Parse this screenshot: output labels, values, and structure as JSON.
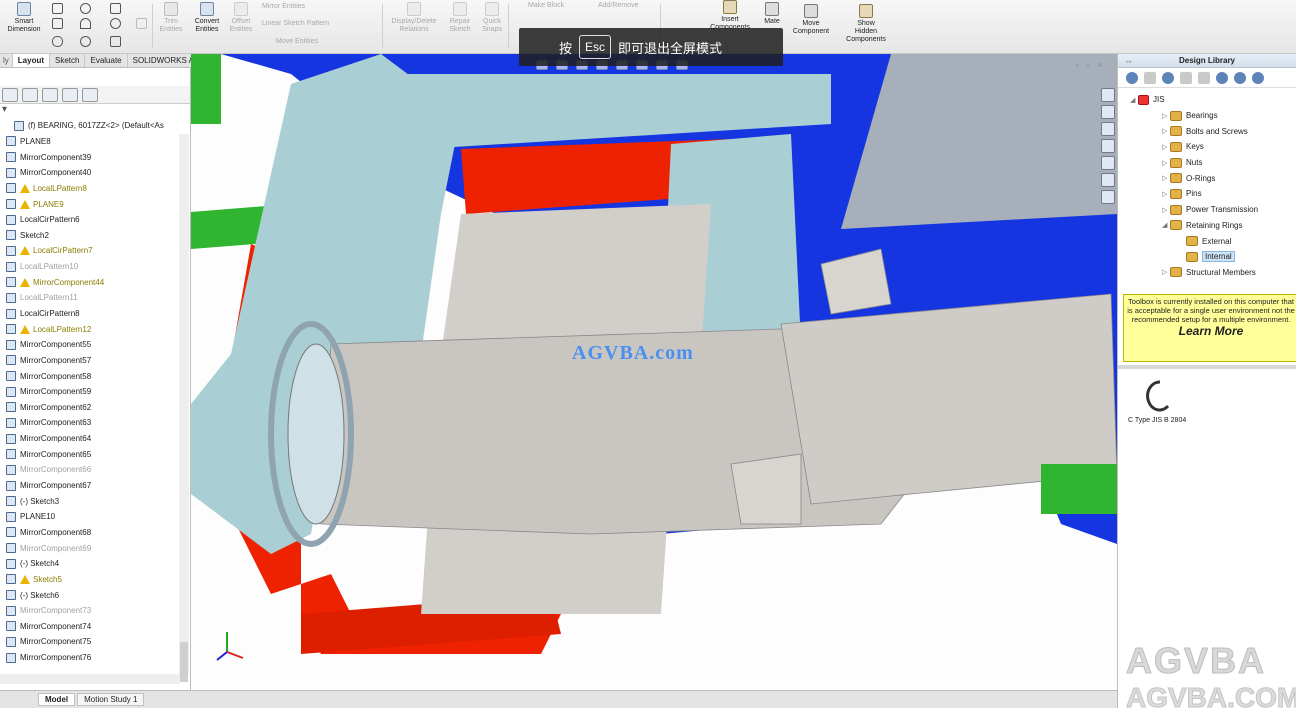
{
  "ribbon": {
    "smart_dimension": "Smart\nDimension",
    "trim_entities": "Trim\nEntities",
    "convert_entities": "Convert\nEntities",
    "offset_entities": "Offset\nEntities",
    "mirror_entities": "Mirror Entities",
    "linear_sketch_pattern": "Linear Sketch Pattern",
    "move_entities": "Move Entities",
    "display_delete_relations": "Display/Delete\nRelations",
    "repair_sketch": "Repair\nSketch",
    "quick_snaps": "Quick\nSnaps",
    "make_block": "Make Block",
    "add_remove": "Add/Remove",
    "insert_components": "Insert\nComponents",
    "mate": "Mate",
    "move_component": "Move\nComponent",
    "show_hidden_components": "Show\nHidden\nComponents"
  },
  "cmd_tabs": [
    "Layout",
    "Sketch",
    "Evaluate",
    "SOLIDWORKS Add-Ins"
  ],
  "esc_overlay": {
    "prefix": "按",
    "key": "Esc",
    "suffix": "即可退出全屏模式"
  },
  "tree": [
    {
      "label": "(f) BEARING, 6017ZZ<2> (Default<As",
      "style": "normal"
    },
    {
      "label": "PLANE8",
      "style": "normal"
    },
    {
      "label": "MirrorComponent39",
      "style": "normal"
    },
    {
      "label": "MirrorComponent40",
      "style": "normal"
    },
    {
      "label": "LocalLPattern8",
      "style": "yellow"
    },
    {
      "label": "PLANE9",
      "style": "yellow"
    },
    {
      "label": "LocalCirPattern6",
      "style": "normal"
    },
    {
      "label": "Sketch2",
      "style": "normal"
    },
    {
      "label": "LocalCirPattern7",
      "style": "yellow"
    },
    {
      "label": "LocalLPattern10",
      "style": "grey"
    },
    {
      "label": "MirrorComponent44",
      "style": "yellow"
    },
    {
      "label": "LocalLPattern11",
      "style": "grey"
    },
    {
      "label": "LocalCirPattern8",
      "style": "normal"
    },
    {
      "label": "LocalLPattern12",
      "style": "yellow"
    },
    {
      "label": "MirrorComponent55",
      "style": "normal"
    },
    {
      "label": "MirrorComponent57",
      "style": "normal"
    },
    {
      "label": "MirrorComponent58",
      "style": "normal"
    },
    {
      "label": "MirrorComponent59",
      "style": "normal"
    },
    {
      "label": "MirrorComponent62",
      "style": "normal"
    },
    {
      "label": "MirrorComponent63",
      "style": "normal"
    },
    {
      "label": "MirrorComponent64",
      "style": "normal"
    },
    {
      "label": "MirrorComponent65",
      "style": "normal"
    },
    {
      "label": "MirrorComponent66",
      "style": "grey"
    },
    {
      "label": "MirrorComponent67",
      "style": "normal"
    },
    {
      "label": "(-) Sketch3",
      "style": "normal"
    },
    {
      "label": "PLANE10",
      "style": "normal"
    },
    {
      "label": "MirrorComponent68",
      "style": "normal"
    },
    {
      "label": "MirrorComponent69",
      "style": "grey"
    },
    {
      "label": "(-) Sketch4",
      "style": "normal"
    },
    {
      "label": "Sketch5",
      "style": "yellow"
    },
    {
      "label": "(-) Sketch6",
      "style": "normal"
    },
    {
      "label": "MirrorComponent73",
      "style": "grey"
    },
    {
      "label": "MirrorComponent74",
      "style": "normal"
    },
    {
      "label": "MirrorComponent75",
      "style": "normal"
    },
    {
      "label": "MirrorComponent76",
      "style": "normal"
    }
  ],
  "bottom_tabs": [
    "Model",
    "Motion Study 1"
  ],
  "design_library": {
    "title": "Design Library",
    "root": "JIS",
    "items": [
      {
        "label": "Bearings",
        "selected": false
      },
      {
        "label": "Bolts and Screws",
        "selected": false
      },
      {
        "label": "Keys",
        "selected": false
      },
      {
        "label": "Nuts",
        "selected": false
      },
      {
        "label": "O-Rings",
        "selected": false
      },
      {
        "label": "Pins",
        "selected": false
      },
      {
        "label": "Power Transmission",
        "selected": false
      },
      {
        "label": "Retaining Rings",
        "selected": false
      },
      {
        "label": "External",
        "selected": false
      },
      {
        "label": "Internal",
        "selected": true
      },
      {
        "label": "Structural Members",
        "selected": false
      }
    ],
    "note": "Toolbox is currently installed on this computer that is acceptable for a single user environment not the recommended setup for a multiple environment.",
    "note_link": "Learn More",
    "part_label": "C Type JIS B 2804"
  },
  "watermark": {
    "center": "AGVBA.com",
    "corner_top": "AGVBA",
    "corner_bottom": "AGVBA.COM"
  },
  "colors": {
    "model_grey": "#c9c6c2",
    "model_blue": "#1133dd",
    "model_red": "#ee2200",
    "model_teal": "#a9cfd4",
    "model_green": "#22bb22"
  }
}
